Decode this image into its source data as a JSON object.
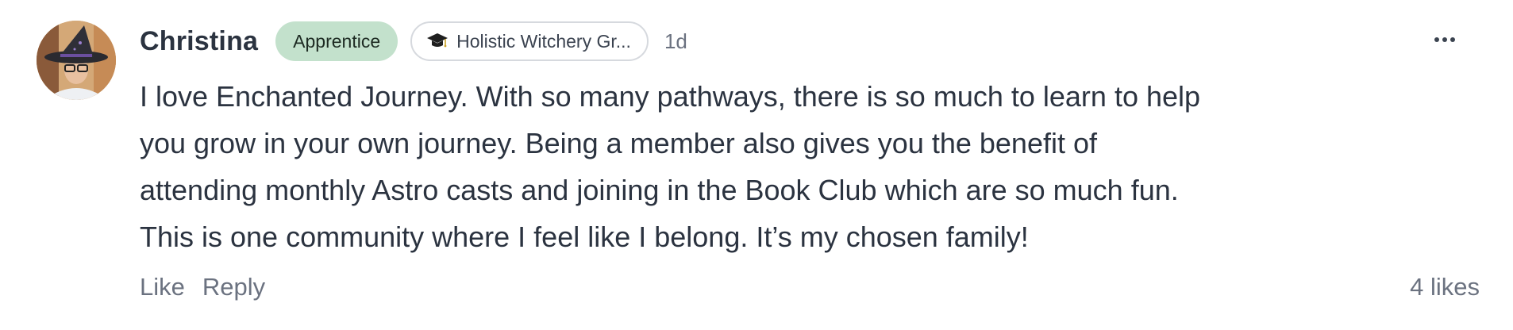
{
  "comment": {
    "author": "Christina",
    "badge": "Apprentice",
    "space": {
      "icon": "graduation-cap-icon",
      "label": "Holistic Witchery Gr..."
    },
    "timestamp": "1d",
    "text_lines": [
      "I love Enchanted Journey. With so many pathways, there is so much to learn to help",
      "you grow in your own journey. Being a member also gives you the benefit of",
      "attending monthly Astro casts and joining in the Book Club which are so much fun.",
      "This is one community where I feel like I belong. It’s my chosen family!"
    ],
    "actions": {
      "like": "Like",
      "reply": "Reply"
    },
    "likes": "4 likes"
  },
  "colors": {
    "badge_bg": "#c3e1cc",
    "text": "#2b3340",
    "muted": "#6b7280",
    "pill_border": "#d6d9de"
  }
}
